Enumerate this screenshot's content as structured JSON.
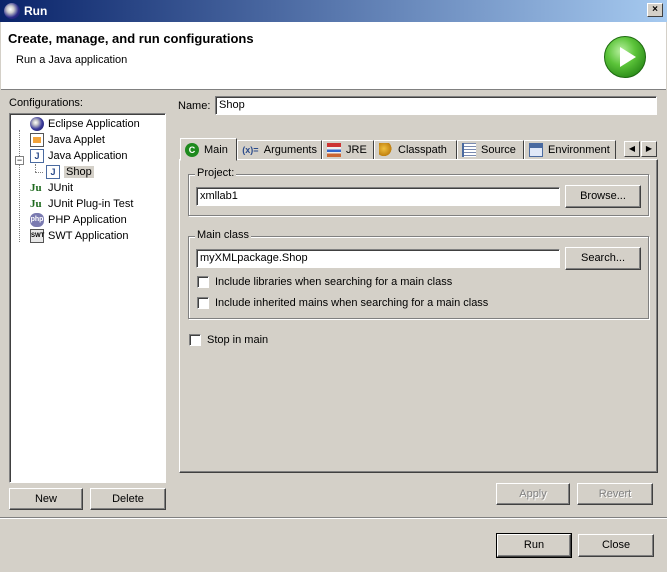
{
  "window": {
    "title": "Run",
    "close_glyph": "×"
  },
  "header": {
    "title": "Create, manage, and run configurations",
    "subtitle": "Run a Java application",
    "icon": "run-icon"
  },
  "sidebar": {
    "label": "Configurations:",
    "items": [
      {
        "label": "Eclipse Application",
        "icon": "eclipse-icon"
      },
      {
        "label": "Java Applet",
        "icon": "java-applet-icon"
      },
      {
        "label": "Java Application",
        "icon": "java-application-icon",
        "expanded": true
      },
      {
        "label": "Shop",
        "icon": "java-class-icon",
        "selected": true
      },
      {
        "label": "JUnit",
        "icon": "junit-icon"
      },
      {
        "label": "JUnit Plug-in Test",
        "icon": "junit-plugin-icon"
      },
      {
        "label": "PHP Application",
        "icon": "php-icon"
      },
      {
        "label": "SWT Application",
        "icon": "swt-icon"
      }
    ],
    "new_label": "New",
    "delete_label": "Delete"
  },
  "name": {
    "label": "Name:",
    "value": "Shop"
  },
  "tabs": [
    {
      "label": "Main",
      "icon": "main-tab-icon",
      "active": true
    },
    {
      "label": "Arguments",
      "icon": "arguments-icon"
    },
    {
      "label": "JRE",
      "icon": "jre-icon"
    },
    {
      "label": "Classpath",
      "icon": "classpath-icon"
    },
    {
      "label": "Source",
      "icon": "source-icon"
    },
    {
      "label": "Environment",
      "icon": "environment-icon"
    }
  ],
  "tab_icon_text": {
    "main": "C",
    "arguments": "(x)=",
    "java": "J",
    "junit": "Ju",
    "php": "php",
    "swt": "SWT"
  },
  "tab_scroll": {
    "left": "◀",
    "right": "▶"
  },
  "main": {
    "project_group": "Project:",
    "project_value": "xmllab1",
    "browse_label": "Browse...",
    "main_class_group": "Main class",
    "main_class_value": "myXMLpackage.Shop",
    "search_label": "Search...",
    "include_libraries": "Include libraries when searching for a main class",
    "include_inherited": "Include inherited mains when searching for a main class",
    "stop_in_main": "Stop in main"
  },
  "actions": {
    "apply": "Apply",
    "revert": "Revert",
    "run": "Run",
    "close": "Close"
  }
}
